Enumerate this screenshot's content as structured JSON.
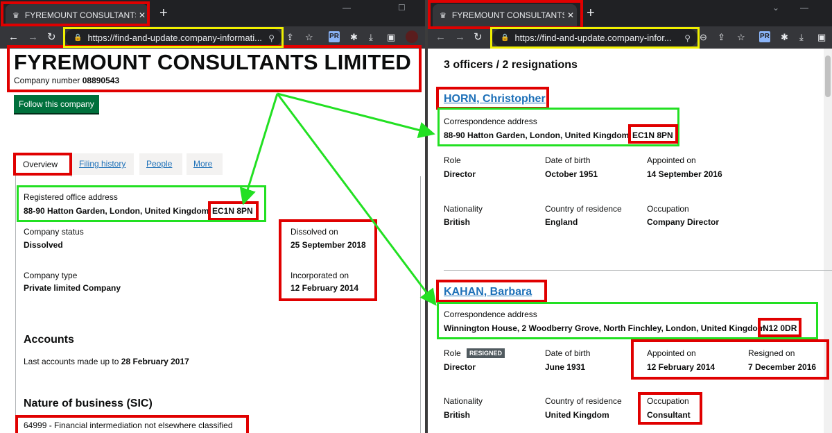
{
  "left": {
    "tab_title": "FYREMOUNT CONSULTANTS LIMI",
    "url": "https://find-and-update.company-informati...",
    "company_name": "FYREMOUNT CONSULTANTS LIMITED",
    "company_number_label": "Company number",
    "company_number": "08890543",
    "follow_button": "Follow this company",
    "tabs": [
      "Overview",
      "Filing history",
      "People",
      "More"
    ],
    "registered_office_label": "Registered office address",
    "registered_office": "88-90 Hatton Garden, London, United Kingdom",
    "registered_postcode": "EC1N 8PN",
    "company_status_label": "Company status",
    "company_status": "Dissolved",
    "dissolved_label": "Dissolved on",
    "dissolved_value": "25 September 2018",
    "company_type_label": "Company type",
    "company_type": "Private limited Company",
    "incorporated_label": "Incorporated on",
    "incorporated_value": "12 February 2014",
    "accounts_heading": "Accounts",
    "accounts_text": "Last accounts made up to",
    "accounts_date": "28 February 2017",
    "sic_heading": "Nature of business (SIC)",
    "sic_value": "64999 - Financial intermediation not elsewhere classified"
  },
  "right": {
    "tab_title": "FYREMOUNT CONSULTANTS LIM",
    "url": "https://find-and-update.company-infor...",
    "officers_heading": "3 officers / 2 resignations",
    "officer1": {
      "name": "HORN, Christopher",
      "address_label": "Correspondence address",
      "address": "88-90 Hatton Garden, London, United Kingdom",
      "postcode": "EC1N 8PN",
      "role_label": "Role",
      "role": "Director",
      "dob_label": "Date of birth",
      "dob": "October 1951",
      "appointed_label": "Appointed on",
      "appointed": "14 September 2016",
      "nationality_label": "Nationality",
      "nationality": "British",
      "residence_label": "Country of residence",
      "residence": "England",
      "occupation_label": "Occupation",
      "occupation": "Company Director"
    },
    "officer2": {
      "name": "KAHAN, Barbara",
      "address_label": "Correspondence address",
      "address": "Winnington House, 2 Woodberry Grove, North Finchley, London, United Kingdom",
      "postcode": "N12 0DR",
      "role_label": "Role",
      "resigned_badge": "RESIGNED",
      "role": "Director",
      "dob_label": "Date of birth",
      "dob": "June 1931",
      "appointed_label": "Appointed on",
      "appointed": "12 February 2014",
      "resigned_label": "Resigned on",
      "resigned": "7 December 2016",
      "nationality_label": "Nationality",
      "nationality": "British",
      "residence_label": "Country of residence",
      "residence": "United Kingdom",
      "occupation_label": "Occupation",
      "occupation": "Consultant"
    }
  },
  "colors": {
    "highlight_red": "#e00000",
    "highlight_green": "#22e022",
    "govuk_link": "#1d70b8",
    "follow_button": "#00703c",
    "browser_dark": "#202124"
  }
}
